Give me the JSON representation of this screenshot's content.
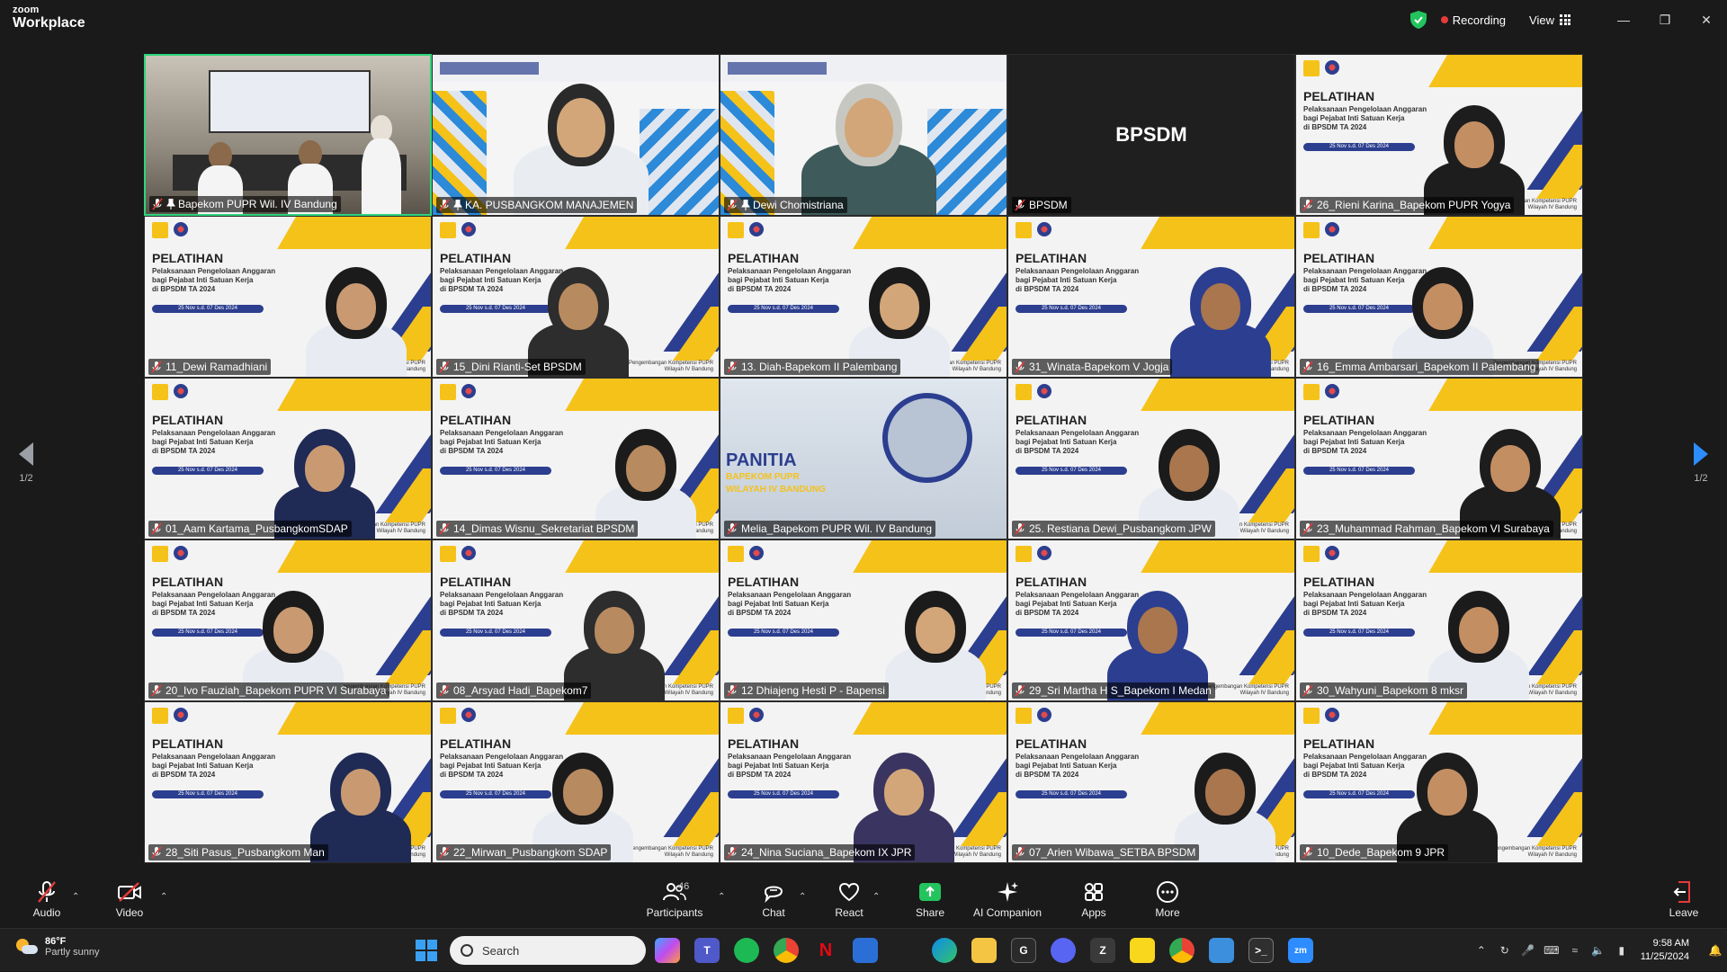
{
  "app": {
    "brand_small": "zoom",
    "brand_large": "Workplace"
  },
  "titlebar": {
    "recording_label": "Recording",
    "view_label": "View"
  },
  "pagination": {
    "left": "1/2",
    "right": "1/2"
  },
  "slide": {
    "title": "PELATIHAN",
    "subtitle_line1": "Pelaksanaan Pengelolaan Anggaran",
    "subtitle_line2": "bagi Pejabat Inti Satuan Kerja",
    "subtitle_line3": "di BPSDM TA 2024",
    "date": "25 Nov s.d. 07 Des 2024",
    "footer_line1": "Pengembangan Kompetensi PUPR",
    "footer_line2": "Wilayah IV Bandung"
  },
  "tiles": [
    {
      "name": "Bapekom PUPR Wil. IV Bandung",
      "type": "room",
      "active": true,
      "hand": true
    },
    {
      "name": "KA. PUSBANGKOM MANAJEMEN",
      "type": "banner",
      "hand": true
    },
    {
      "name": "Dewi Chomistriana",
      "type": "banner",
      "hand": true
    },
    {
      "name": "BPSDM",
      "type": "dark",
      "label": "BPSDM"
    },
    {
      "name": "26_Rieni Karina_Bapekom PUPR Yogya",
      "type": "slide"
    },
    {
      "name": "11_Dewi Ramadhiani",
      "type": "slide"
    },
    {
      "name": "15_Dini Rianti-Set BPSDM",
      "type": "slide"
    },
    {
      "name": "13. Diah-Bapekom II Palembang",
      "type": "slide"
    },
    {
      "name": "31_Winata-Bapekom V Jogja",
      "type": "slide"
    },
    {
      "name": "16_Emma Ambarsari_Bapekom II Palembang",
      "type": "slide"
    },
    {
      "name": "01_Aam Kartama_PusbangkomSDAP",
      "type": "slide"
    },
    {
      "name": "14_Dimas Wisnu_Sekretariat BPSDM",
      "type": "slide"
    },
    {
      "name": "Melia_Bapekom PUPR Wil. IV Bandung",
      "type": "panitia",
      "panitia_line1": "PANITIA",
      "panitia_line2": "BAPEKOM PUPR",
      "panitia_line3": "WILAYAH IV BANDUNG"
    },
    {
      "name": "25. Restiana Dewi_Pusbangkom JPW",
      "type": "slide"
    },
    {
      "name": "23_Muhammad Rahman_Bapekom VI Surabaya",
      "type": "slide"
    },
    {
      "name": "20_Ivo Fauziah_Bapekom PUPR VI Surabaya",
      "type": "slide"
    },
    {
      "name": "08_Arsyad Hadi_Bapekom7",
      "type": "slide"
    },
    {
      "name": "12 Dhiajeng Hesti P - Bapensi",
      "type": "slide"
    },
    {
      "name": "29_Sri Martha H S_Bapekom I Medan",
      "type": "slide"
    },
    {
      "name": "30_Wahyuni_Bapekom 8 mksr",
      "type": "slide"
    },
    {
      "name": "28_Siti Pasus_Pusbangkom Man",
      "type": "slide"
    },
    {
      "name": "22_Mirwan_Pusbangkom SDAP",
      "type": "slide"
    },
    {
      "name": "24_Nina Suciana_Bapekom IX JPR",
      "type": "slide"
    },
    {
      "name": "07_Arien Wibawa_SETBA BPSDM",
      "type": "slide"
    },
    {
      "name": "10_Dede_Bapekom 9 JPR",
      "type": "slide"
    }
  ],
  "toolbar": {
    "audio": "Audio",
    "video": "Video",
    "participants": "Participants",
    "participants_count": "46",
    "chat": "Chat",
    "react": "React",
    "share": "Share",
    "ai_companion": "AI Companion",
    "apps": "Apps",
    "more": "More",
    "leave": "Leave"
  },
  "taskbar": {
    "weather_temp": "86°F",
    "weather_desc": "Partly sunny",
    "search_placeholder": "Search",
    "time": "9:58 AM",
    "date": "11/25/2024"
  },
  "colors": {
    "accent": "#2d8cff",
    "active_border": "#2fd57c",
    "record": "#e53b3b",
    "slide_yellow": "#f5c21a",
    "slide_blue": "#2c3e8f"
  }
}
